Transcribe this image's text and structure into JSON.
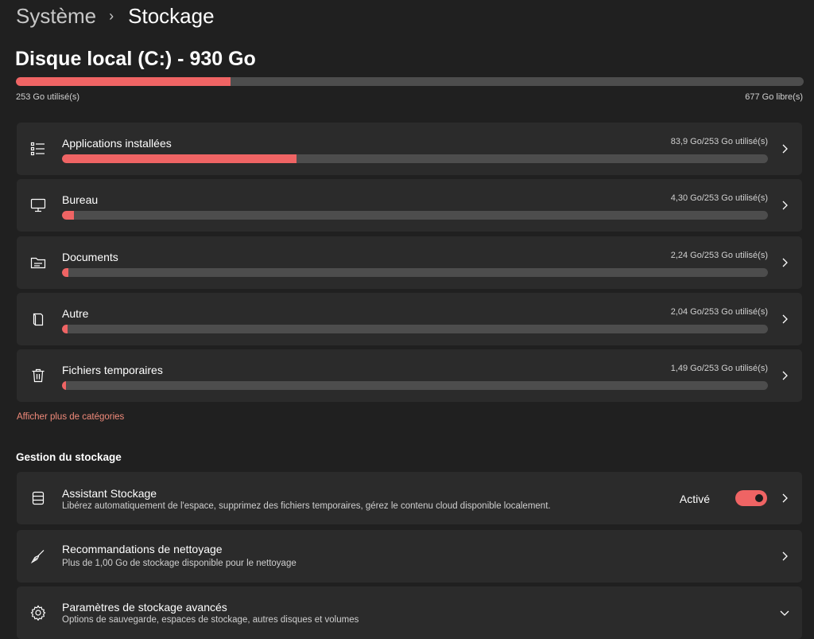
{
  "breadcrumb": {
    "parent": "Système",
    "separator": "›",
    "current": "Stockage"
  },
  "disk": {
    "title": "Disque local (C:) - 930 Go",
    "used_label": "253 Go utilisé(s)",
    "free_label": "677 Go libre(s)",
    "used_fraction": 0.272
  },
  "categories": [
    {
      "label": "Applications installées",
      "usage": "83,9 Go/253 Go utilisé(s)",
      "fraction": 0.332,
      "icon": "apps-list-icon"
    },
    {
      "label": "Bureau",
      "usage": "4,30 Go/253 Go utilisé(s)",
      "fraction": 0.017,
      "icon": "monitor-icon"
    },
    {
      "label": "Documents",
      "usage": "2,24 Go/253 Go utilisé(s)",
      "fraction": 0.009,
      "icon": "folder-icon"
    },
    {
      "label": "Autre",
      "usage": "2,04 Go/253 Go utilisé(s)",
      "fraction": 0.008,
      "icon": "document-icon"
    },
    {
      "label": "Fichiers temporaires",
      "usage": "1,49 Go/253 Go utilisé(s)",
      "fraction": 0.006,
      "icon": "trash-icon"
    }
  ],
  "more_categories_link": "Afficher plus de catégories",
  "management": {
    "section_title": "Gestion du stockage",
    "items": [
      {
        "title": "Assistant Stockage",
        "subtitle": "Libérez automatiquement de l'espace, supprimez des fichiers temporaires, gérez le contenu cloud disponible localement.",
        "toggle_label": "Activé",
        "toggle_on": true,
        "icon": "storage-drive-icon"
      },
      {
        "title": "Recommandations de nettoyage",
        "subtitle": "Plus de 1,00 Go de stockage disponible pour le nettoyage",
        "icon": "broom-icon"
      },
      {
        "title": "Paramètres de stockage avancés",
        "subtitle": "Options de sauvegarde, espaces de stockage, autres disques et volumes",
        "icon": "gear-icon"
      }
    ]
  },
  "colors": {
    "accent": "#ef6464",
    "background": "#202020",
    "card": "#2b2b2b",
    "track": "#4d4d4d",
    "link": "#f08a7a"
  }
}
